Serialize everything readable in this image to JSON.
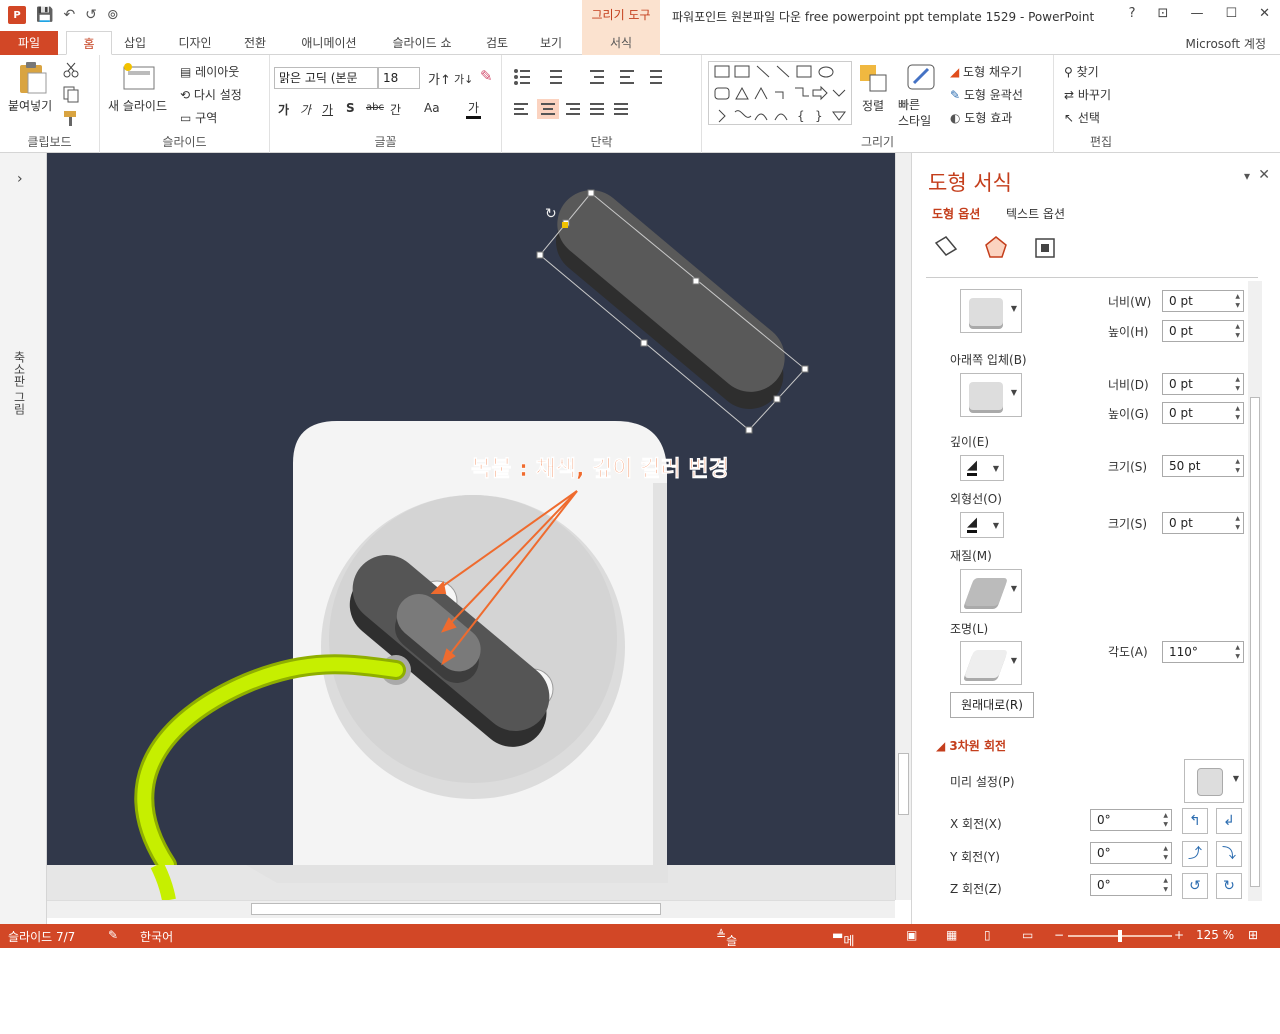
{
  "window": {
    "app_logo": "P",
    "title": "파워포인트 원본파일 다운 free powerpoint ppt template 1529 - PowerPoint",
    "context_tab_header": "그리기 도구",
    "help": "?",
    "restore_ribbon": "⊡",
    "minimize": "—",
    "maximize": "☐",
    "close": "✕"
  },
  "qat": {
    "save": "💾",
    "undo": "↶",
    "redo": "↺",
    "slideshow": "⊚"
  },
  "tabs": [
    {
      "label": "파일"
    },
    {
      "label": "홈"
    },
    {
      "label": "삽입"
    },
    {
      "label": "디자인"
    },
    {
      "label": "전환"
    },
    {
      "label": "애니메이션"
    },
    {
      "label": "슬라이드 쇼"
    },
    {
      "label": "검토"
    },
    {
      "label": "보기"
    },
    {
      "label": "서식"
    }
  ],
  "account": "Microsoft 계정",
  "ribbon": {
    "clipboard": {
      "label": "클립보드",
      "paste": "붙여넣기"
    },
    "slides": {
      "label": "슬라이드",
      "new_slide": "새 슬라이드",
      "layout": "레이아웃",
      "reset": "다시 설정",
      "section": "구역"
    },
    "font": {
      "label": "글꼴",
      "font_name": "맑은 고딕 (본문",
      "font_size": "18",
      "bold": "가",
      "italic": "가",
      "underline": "가",
      "shadow": "S",
      "strike": "abc",
      "spacing": "간",
      "case": "Aa",
      "color": "가"
    },
    "paragraph": {
      "label": "단락"
    },
    "drawing": {
      "label": "그리기",
      "arrange": "정렬",
      "quick_styles": "빠른\n스타일",
      "fill": "도형 채우기",
      "outline": "도형 윤곽선",
      "effects": "도형 효과"
    },
    "editing": {
      "label": "편집",
      "find": "찾기",
      "replace": "바꾸기",
      "select": "선택"
    }
  },
  "left_strip": {
    "label": "축소판 그림",
    "expand": "›"
  },
  "annotation": "복붙 : 채색, 깊이 컬러 변경",
  "panel": {
    "title": "도형 서식",
    "tab_shape": "도형 옵션",
    "tab_text": "텍스트 옵션",
    "top_bevel_width_label": "너비(W)",
    "top_bevel_width": "0 pt",
    "top_bevel_height_label": "높이(H)",
    "top_bevel_height": "0 pt",
    "bottom_bevel_label": "아래쪽 입체(B)",
    "bottom_bevel_width_label": "너비(D)",
    "bottom_bevel_width": "0 pt",
    "bottom_bevel_height_label": "높이(G)",
    "bottom_bevel_height": "0 pt",
    "depth_label": "깊이(E)",
    "depth_size_label": "크기(S)",
    "depth_size": "50 pt",
    "contour_label": "외형선(O)",
    "contour_size_label": "크기(S)",
    "contour_size": "0 pt",
    "material_label": "재질(M)",
    "lighting_label": "조명(L)",
    "angle_label": "각도(A)",
    "angle": "110°",
    "reset_button": "원래대로(R)",
    "rotation_section": "3차원 회전",
    "preset_label": "미리 설정(P)",
    "x_label": "X 회전(X)",
    "x_value": "0°",
    "y_label": "Y 회전(Y)",
    "y_value": "0°",
    "z_label": "Z 회전(Z)",
    "z_value": "0°",
    "pin": "▾",
    "close": "✕"
  },
  "status": {
    "slide": "슬라이드 7/7",
    "language": "한국어",
    "notes": "슬라이드 노트",
    "comments": "메모",
    "zoom": "125 %",
    "zoom_minus": "−",
    "zoom_plus": "+"
  },
  "colors": {
    "accent": "#d24726",
    "slide_bg": "#31384a",
    "annotation": "#ef6b2e",
    "cable": "#c6ef00"
  }
}
